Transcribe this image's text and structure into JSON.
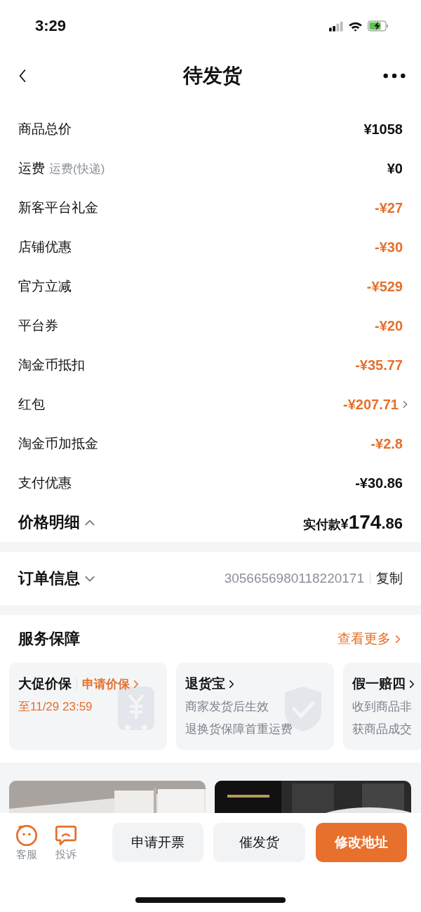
{
  "status_bar": {
    "time": "3:29"
  },
  "nav": {
    "title": "待发货"
  },
  "price_rows": [
    {
      "label": "商品总价",
      "amount": "¥1058",
      "kind": "plain",
      "chevron": false
    },
    {
      "label": "运费",
      "note": "运费(快递)",
      "amount": "¥0",
      "kind": "plain",
      "chevron": false
    },
    {
      "label": "新客平台礼金",
      "amount": "-¥27",
      "kind": "discount",
      "chevron": false
    },
    {
      "label": "店铺优惠",
      "amount": "-¥30",
      "kind": "discount",
      "chevron": false
    },
    {
      "label": "官方立减",
      "amount": "-¥529",
      "kind": "discount",
      "chevron": false
    },
    {
      "label": "平台券",
      "amount": "-¥20",
      "kind": "discount",
      "chevron": false
    },
    {
      "label": "淘金币抵扣",
      "amount": "-¥35.77",
      "kind": "discount",
      "chevron": false
    },
    {
      "label": "红包",
      "amount": "-¥207.71",
      "kind": "discount",
      "chevron": true
    },
    {
      "label": "淘金币加抵金",
      "amount": "-¥2.8",
      "kind": "discount",
      "chevron": false
    },
    {
      "label": "支付优惠",
      "amount": "-¥30.86",
      "kind": "plain",
      "chevron": false
    }
  ],
  "price_total": {
    "title": "价格明细",
    "expanded": true,
    "label": "实付款",
    "currency": "¥",
    "integer": "174",
    "decimal": ".86"
  },
  "order_info": {
    "title": "订单信息",
    "expanded": false,
    "order_number": "3056656980118220171",
    "copy": "复制"
  },
  "services": {
    "title": "服务保障",
    "more": "查看更多",
    "cards": [
      {
        "kind": "deadline",
        "title": "大促价保",
        "action": "申请价保",
        "lines": [
          "至11/29 23:59"
        ]
      },
      {
        "kind": "info",
        "title": "退货宝",
        "lines": [
          "商家发货后生效",
          "退换货保障首重运费"
        ]
      },
      {
        "kind": "info",
        "title": "假一赔四",
        "lines": [
          "收到商品非",
          "获商品成交"
        ]
      }
    ]
  },
  "bottom_bar": {
    "icon_actions": [
      {
        "kind": "service",
        "label": "客服"
      },
      {
        "kind": "complain",
        "label": "投诉"
      }
    ],
    "buttons": [
      {
        "label": "申请开票",
        "kind": "secondary"
      },
      {
        "label": "催发货",
        "kind": "secondary"
      },
      {
        "label": "修改地址",
        "kind": "primary"
      }
    ]
  }
}
